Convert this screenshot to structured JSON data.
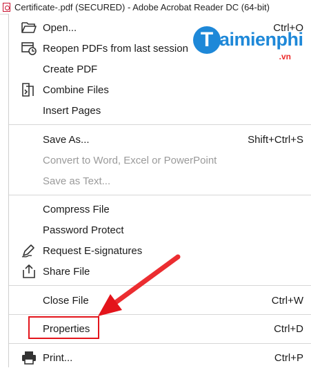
{
  "window": {
    "title": "Certificate-.pdf (SECURED) - Adobe Acrobat Reader DC (64-bit)"
  },
  "watermark": {
    "brand": "aimienphi",
    "brand_initial": "T",
    "tld": ".vn"
  },
  "menu": {
    "open": {
      "label": "Open...",
      "shortcut": "Ctrl+O",
      "icon": "folder-open-icon"
    },
    "reopen": {
      "label": "Reopen PDFs from last session",
      "icon": "reopen-icon"
    },
    "create_pdf": {
      "label": "Create PDF"
    },
    "combine": {
      "label": "Combine Files",
      "icon": "combine-files-icon"
    },
    "insert_pages": {
      "label": "Insert Pages"
    },
    "save_as": {
      "label": "Save As...",
      "shortcut": "Shift+Ctrl+S"
    },
    "convert": {
      "label": "Convert to Word, Excel or PowerPoint"
    },
    "save_text": {
      "label": "Save as Text..."
    },
    "compress": {
      "label": "Compress File"
    },
    "password": {
      "label": "Password Protect"
    },
    "esign": {
      "label": "Request E-signatures",
      "icon": "signature-pen-icon"
    },
    "share": {
      "label": "Share File",
      "icon": "share-icon"
    },
    "close": {
      "label": "Close File",
      "shortcut": "Ctrl+W"
    },
    "properties": {
      "label": "Properties",
      "shortcut": "Ctrl+D"
    },
    "print": {
      "label": "Print...",
      "shortcut": "Ctrl+P",
      "icon": "printer-icon"
    }
  },
  "colors": {
    "annotation_red": "#e3141b",
    "brand_blue": "#1e88d8",
    "disabled_text": "#9a9a9a"
  }
}
